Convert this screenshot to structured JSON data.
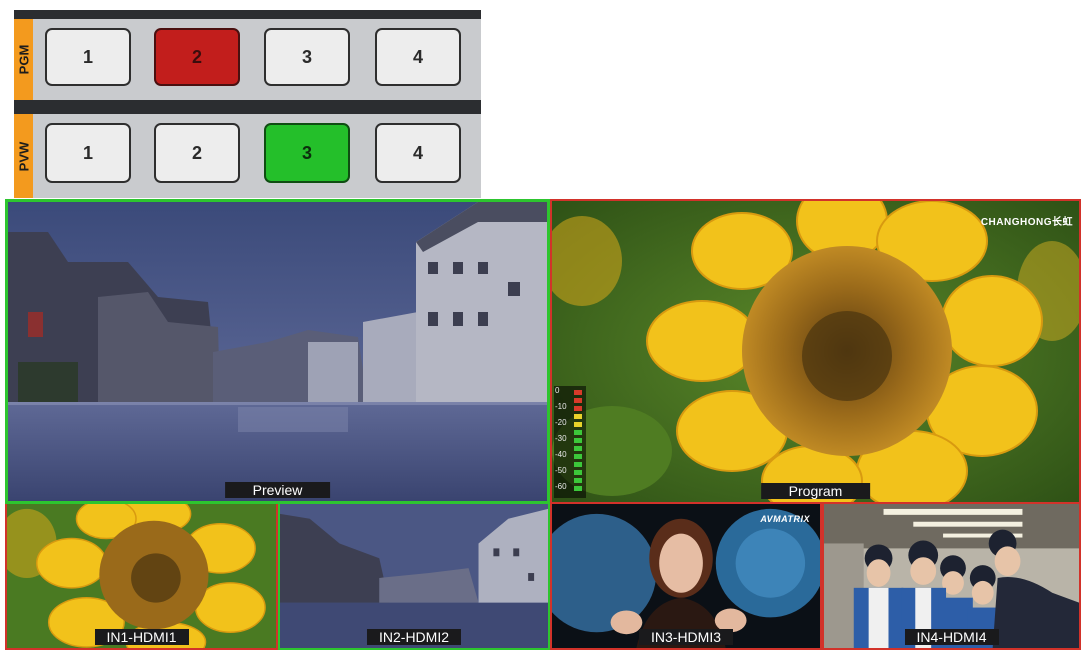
{
  "switcher": {
    "pgm": {
      "label": "PGM",
      "buttons": [
        "1",
        "2",
        "3",
        "4"
      ],
      "active": "2"
    },
    "pvw": {
      "label": "PVW",
      "buttons": [
        "1",
        "2",
        "3",
        "4"
      ],
      "active": "3"
    }
  },
  "multiview": {
    "preview": {
      "label": "Preview"
    },
    "program": {
      "label": "Program",
      "brand": "CHANGHONG长虹",
      "audio_scale": [
        "0",
        "-10",
        "-20",
        "-30",
        "-40",
        "-50",
        "-60"
      ]
    },
    "inputs": [
      {
        "label": "IN1-HDMI1"
      },
      {
        "label": "IN2-HDMI2"
      },
      {
        "label": "IN3-HDMI3",
        "brand": "AVMATRIX"
      },
      {
        "label": "IN4-HDMI4"
      }
    ]
  },
  "colors": {
    "pgm_active": "#c21e1c",
    "pvw_active": "#24bf2a",
    "tally_green": "#2dc52f",
    "tally_red": "#d2322a",
    "tag_orange": "#f39a1e"
  }
}
